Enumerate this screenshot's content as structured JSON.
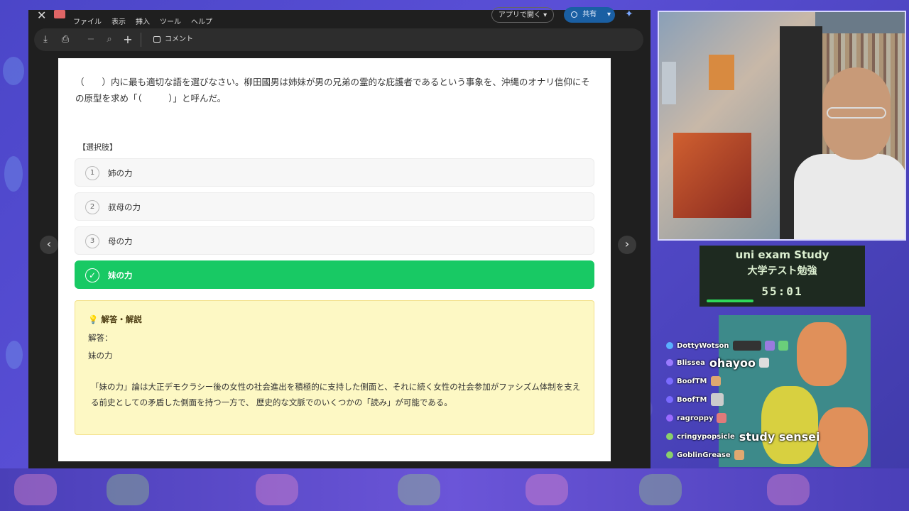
{
  "viewer": {
    "menus": [
      "ファイル",
      "表示",
      "挿入",
      "ツール",
      "ヘルプ"
    ],
    "open_app_label": "アプリで開く",
    "share_label": "共有",
    "comment_label": "コメント"
  },
  "question": {
    "text": "（　　）内に最も適切な語を選びなさい。柳田國男は姉妹が男の兄弟の霊的な庇護者であるという事象を、沖縄のオナリ信仰にその原型を求め「（　　　）」と呼んだ。",
    "choices_label": "【選択肢】",
    "choices": [
      {
        "num": "1",
        "label": "姉の力"
      },
      {
        "num": "2",
        "label": "叔母の力"
      },
      {
        "num": "3",
        "label": "母の力"
      },
      {
        "num": "✓",
        "label": "妹の力"
      }
    ],
    "correct_color": "#18c964"
  },
  "explanation": {
    "title": "解答・解説",
    "answer_label": "解答：",
    "answer_value": "妹の力",
    "body": "「妹の力」論は大正デモクラシー後の女性の社会進出を積極的に支持した側面と、それに続く女性の社会参加がファシズム体制を支える前史としての矛盾した側面を持つ一方で、 歴史的な文脈でのいくつかの「読み」が可能である。"
  },
  "study": {
    "title_en": "uni exam Study",
    "title_ja": "大学テスト勉強",
    "timer": "55:01"
  },
  "chat": [
    {
      "name": "DottyWotson",
      "text": "",
      "dot_color": "#5ab0ff"
    },
    {
      "name": "Blissea",
      "text": "ohayoo",
      "dot_color": "#9a7aff"
    },
    {
      "name": "BoofTM",
      "text": "",
      "dot_color": "#7a6aff"
    },
    {
      "name": "BoofTM",
      "text": "",
      "dot_color": "#7a6aff"
    },
    {
      "name": "ragroppy",
      "text": "",
      "dot_color": "#9a6aff"
    },
    {
      "name": "cringypopsicle",
      "text": "study sensei",
      "dot_color": "#8ad06a"
    },
    {
      "name": "GoblinGrease",
      "text": "",
      "dot_color": "#8ad06a"
    }
  ]
}
